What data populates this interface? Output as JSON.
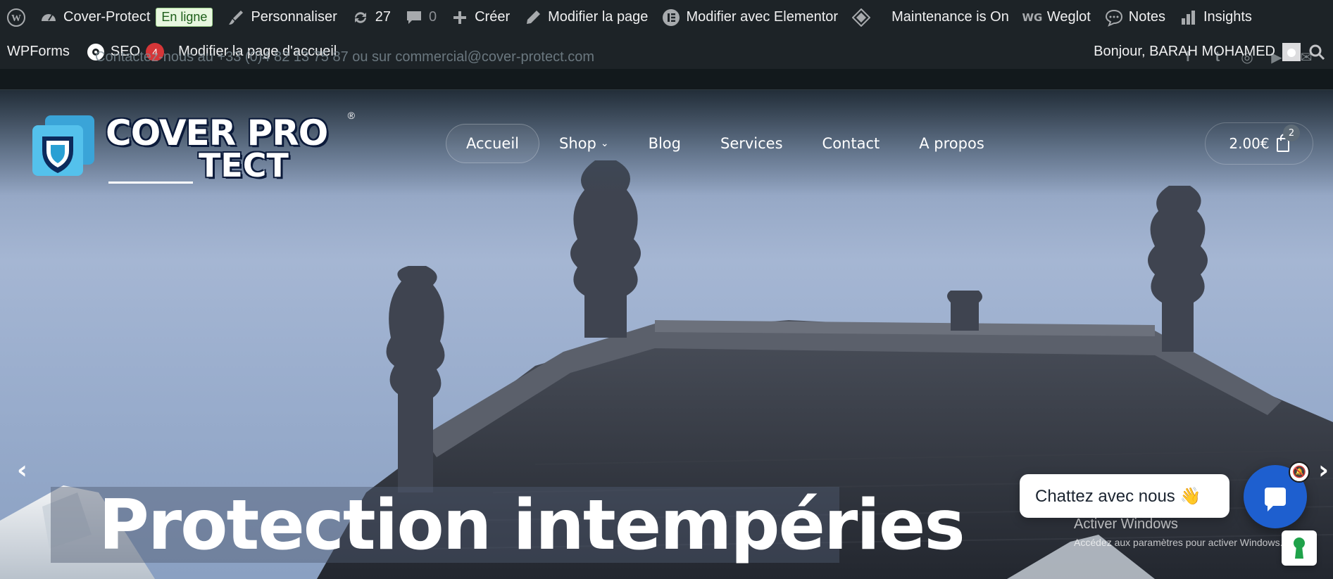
{
  "adminbar": {
    "row1": {
      "site_name": "Cover-Protect",
      "status_badge": "En ligne",
      "customize": "Personnaliser",
      "updates_count": "27",
      "comments_count": "0",
      "create": "Créer",
      "edit_page": "Modifier la page",
      "edit_elementor": "Modifier avec Elementor",
      "maintenance": "Maintenance is On",
      "weglot": "Weglot",
      "notes": "Notes",
      "insights": "Insights"
    },
    "row2": {
      "wpforms": "WPForms",
      "seo": "SEO",
      "seo_count": "4",
      "edit_home": "Modifier la page d'accueil",
      "greeting": "Bonjour, BARAH MOHAMED"
    }
  },
  "topbar": {
    "contact_text": "Contactez-nous au +33 (0)4 82 13 75 87 ou sur commercial@cover-protect.com",
    "social": [
      "facebook-icon",
      "twitter-icon",
      "instagram-icon",
      "youtube-icon",
      "mail-icon"
    ]
  },
  "logo": {
    "line1": "COVER PRO",
    "line2": "TECT",
    "reg": "®"
  },
  "nav": {
    "items": [
      "Accueil",
      "Shop",
      "Blog",
      "Services",
      "Contact",
      "A propos"
    ],
    "active": "Accueil",
    "cart_total": "2.00€",
    "cart_count": "2"
  },
  "hero": {
    "headline": "Protection intempéries",
    "prev": "‹",
    "next": "›"
  },
  "chat": {
    "bubble_text": "Chattez avec nous 👋"
  },
  "windows_watermark": {
    "title": "Activer Windows",
    "subtitle": "Accédez aux paramètres pour activer Windows."
  },
  "colors": {
    "adminbar_bg": "#1d2327",
    "chat_blue": "#1e5fcf",
    "badge_red": "#d63638"
  }
}
